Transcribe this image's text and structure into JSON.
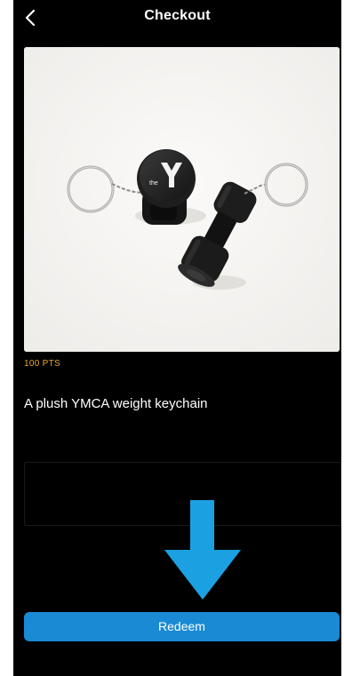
{
  "header": {
    "title": "Checkout",
    "back_icon": "chevron-left-icon"
  },
  "product": {
    "points": "100 PTS",
    "description": "A plush YMCA weight keychain",
    "image_logo_text": "the"
  },
  "actions": {
    "redeem_label": "Redeem"
  },
  "colors": {
    "background": "#000000",
    "points_accent": "#e8a533",
    "button": "#1a8ad4",
    "arrow": "#1ba1e2"
  }
}
